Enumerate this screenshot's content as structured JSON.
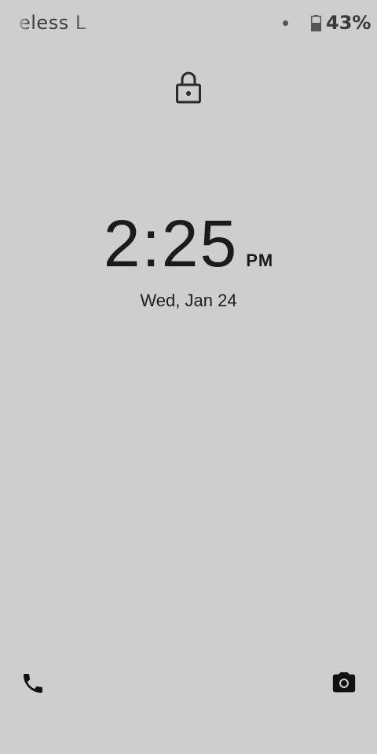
{
  "status_bar": {
    "carrier_label": "eless  L",
    "battery_percent": "43%",
    "battery_level": 0.43
  },
  "lock_screen": {
    "time": "2:25",
    "ampm": "PM",
    "date": "Wed, Jan 24"
  },
  "icons": {
    "lock": "lock-icon",
    "phone": "phone-icon",
    "camera": "camera-icon",
    "battery": "battery-icon",
    "notification": "notification-dot"
  },
  "colors": {
    "background": "#cecece",
    "text": "#1e1e1e",
    "status_text": "#3a3a3a"
  }
}
